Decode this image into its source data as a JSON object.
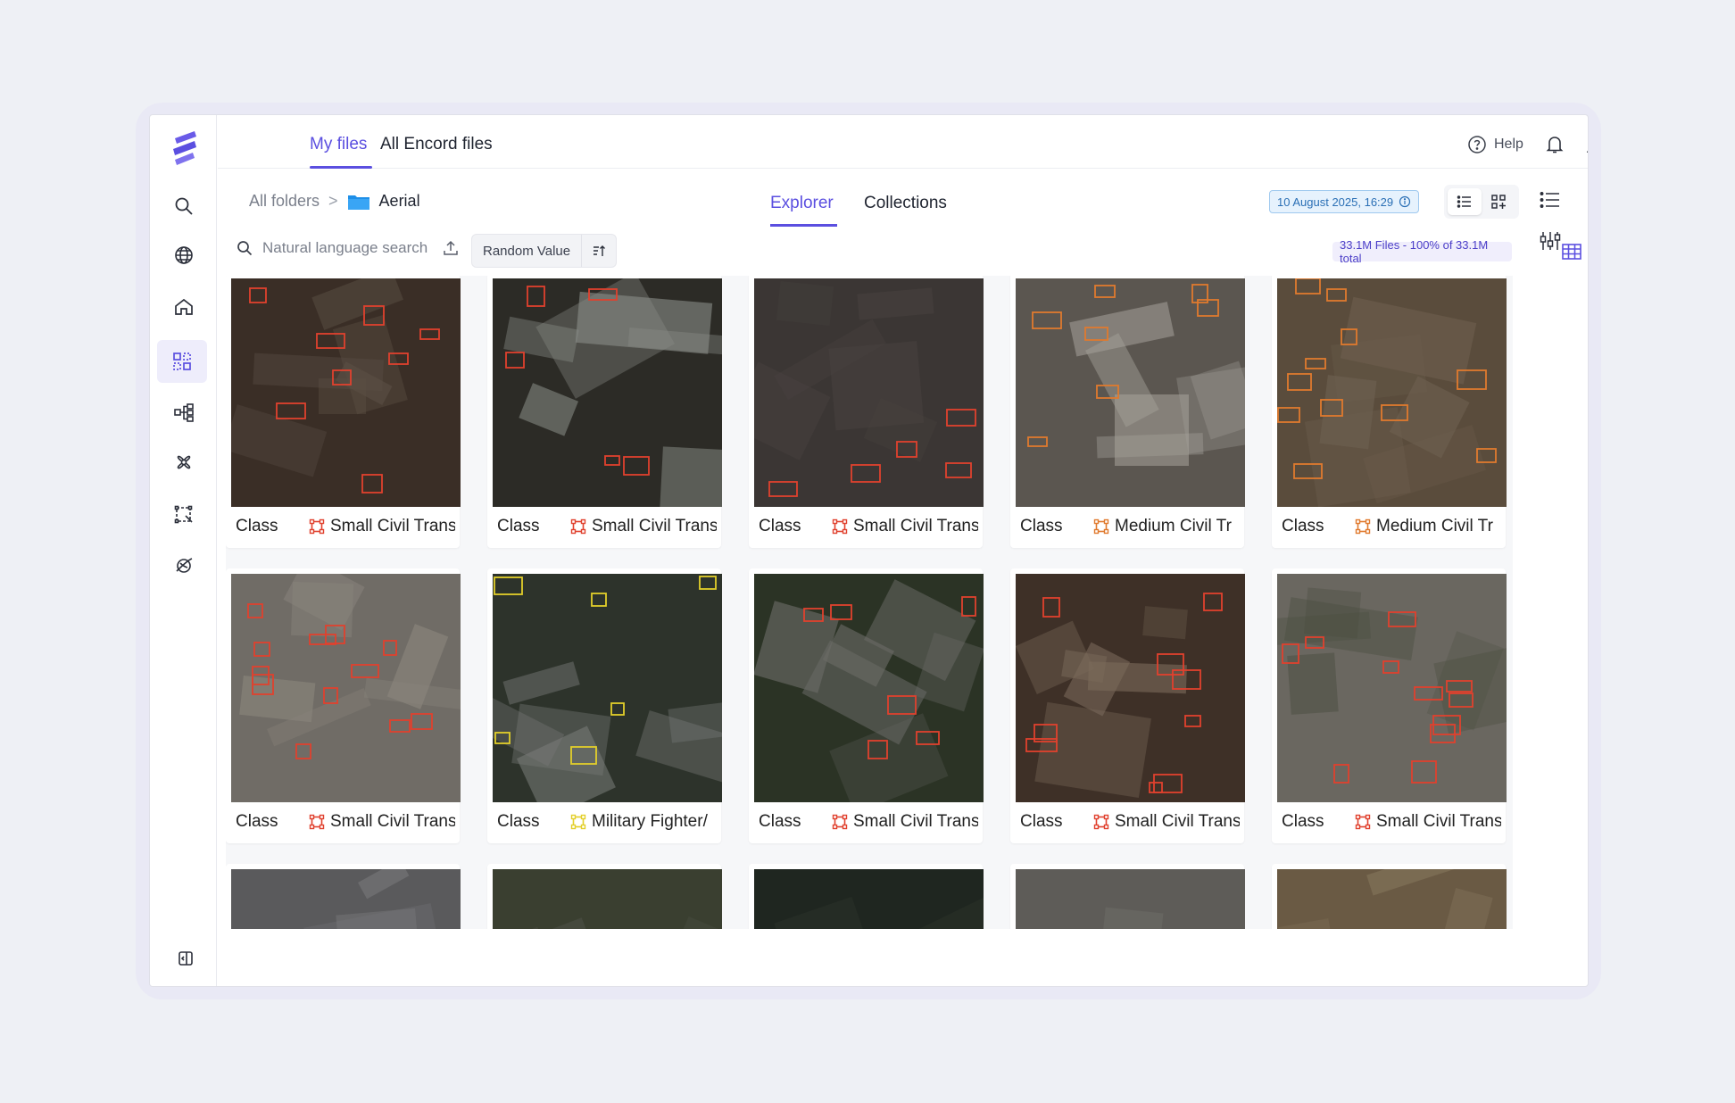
{
  "top_tabs": {
    "my_files": "My files",
    "all_encord": "All Encord files"
  },
  "header": {
    "help": "Help"
  },
  "breadcrumb": {
    "root": "All folders",
    "separator": ">",
    "folder": "Aerial"
  },
  "mid_tabs": {
    "explorer": "Explorer",
    "collections": "Collections"
  },
  "date_badge": "10 August 2025, 16:29",
  "search": {
    "placeholder": "Natural language search"
  },
  "sort": {
    "label": "Random Value"
  },
  "files_badge": "33.1M Files - 100% of 33.1M total",
  "colors": {
    "accent": "#5b4fe0",
    "box_red": "#e0412e",
    "box_orange": "#e07a2e",
    "box_yellow": "#e3cf2a"
  },
  "cards": [
    {
      "label": "Class",
      "name": "Small Civil Trans",
      "icon": "bounding-box-icon",
      "color": "#e0412e",
      "scene": "airfield-dark"
    },
    {
      "label": "Class",
      "name": "Small Civil Trans",
      "icon": "bounding-box-icon",
      "color": "#e0412e",
      "scene": "water"
    },
    {
      "label": "Class",
      "name": "Small Civil Trans",
      "icon": "bounding-box-icon",
      "color": "#e0412e",
      "scene": "apron"
    },
    {
      "label": "Class",
      "name": "Medium Civil Tr",
      "icon": "bounding-box-icon",
      "color": "#e07a2e",
      "scene": "terminal"
    },
    {
      "label": "Class",
      "name": "Medium Civil Tr",
      "icon": "bounding-box-icon",
      "color": "#e07a2e",
      "scene": "tarmac"
    },
    {
      "label": "Class",
      "name": "Small Civil Trans",
      "icon": "bounding-box-icon",
      "color": "#e0412e",
      "scene": "runway"
    },
    {
      "label": "Class",
      "name": "Military Fighter/",
      "icon": "bounding-box-icon",
      "color": "#e3cf2a",
      "scene": "hangar"
    },
    {
      "label": "Class",
      "name": "Small Civil Trans",
      "icon": "bounding-box-icon",
      "color": "#e0412e",
      "scene": "field"
    },
    {
      "label": "Class",
      "name": "Small Civil Trans",
      "icon": "bounding-box-icon",
      "color": "#e0412e",
      "scene": "shore"
    },
    {
      "label": "Class",
      "name": "Small Civil Trans",
      "icon": "bounding-box-icon",
      "color": "#e0412e",
      "scene": "scrub"
    },
    {
      "label": "",
      "name": "",
      "icon": "",
      "color": "#e0412e",
      "scene": "city"
    },
    {
      "label": "",
      "name": "",
      "icon": "",
      "color": "#e0412e",
      "scene": "green"
    },
    {
      "label": "",
      "name": "",
      "icon": "",
      "color": "#e0412e",
      "scene": "darkgreen"
    },
    {
      "label": "",
      "name": "",
      "icon": "",
      "color": "#e0412e",
      "scene": "lot"
    },
    {
      "label": "",
      "name": "",
      "icon": "",
      "color": "#e07a2e",
      "scene": "planes"
    }
  ]
}
